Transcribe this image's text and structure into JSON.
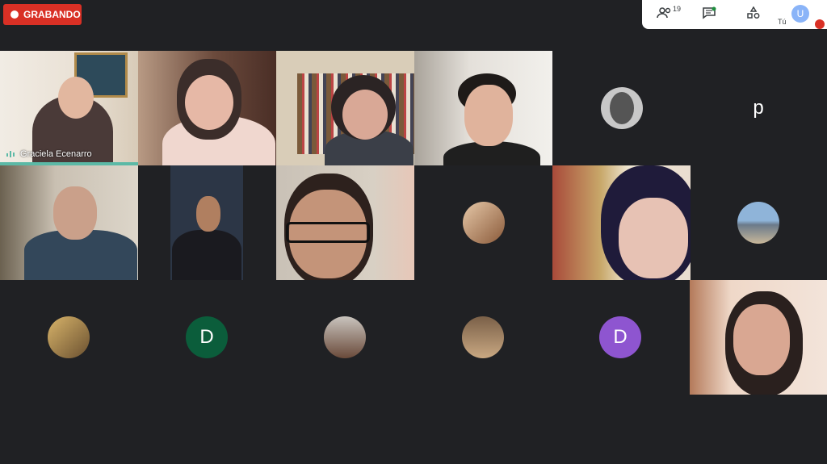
{
  "recording": {
    "label": "GRABANDO"
  },
  "topbar": {
    "participants_count": "19",
    "you_label": "Tú",
    "user_initial": "U"
  },
  "tiles": [
    {
      "name": "Graciela Ecenarro",
      "speaking": true
    },
    {
      "avatar": "p",
      "avatar_color": "#e8710a"
    },
    {
      "avatar": "D",
      "avatar_color": "#0b5d3b"
    },
    {
      "avatar": "D",
      "avatar_color": "#8e55d0"
    }
  ],
  "colors": {
    "recording_red": "#d93025",
    "tile_bg": "#3c4043",
    "page_bg": "#202124",
    "accent": "#5bb9a6"
  }
}
